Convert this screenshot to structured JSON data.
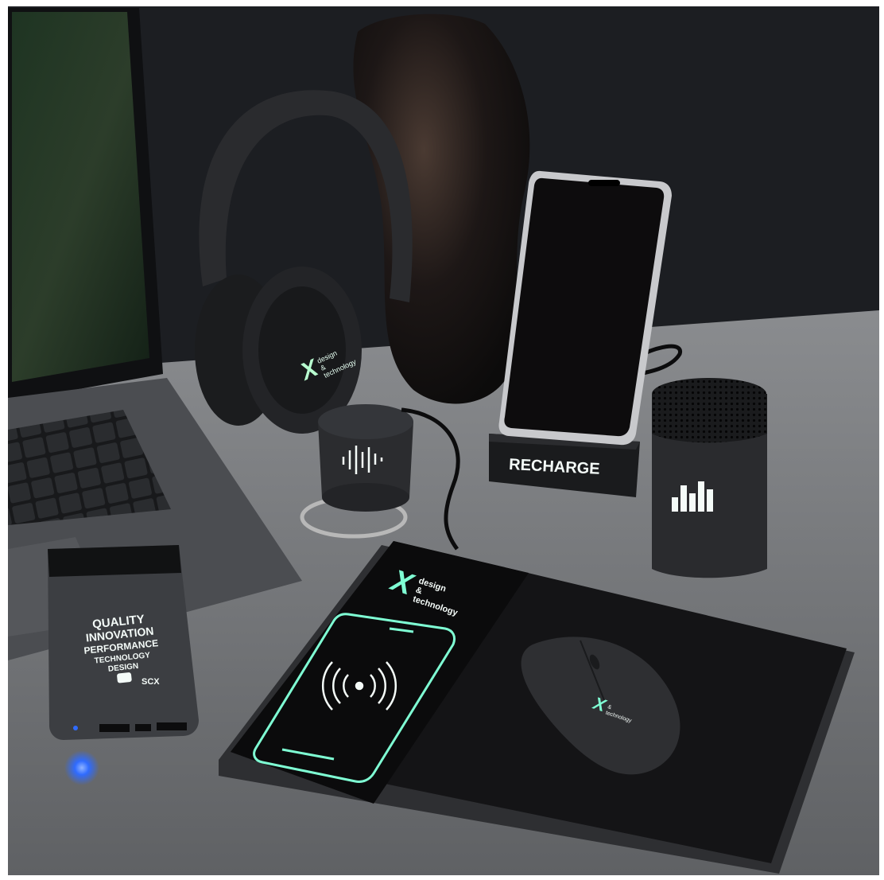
{
  "scene": {
    "headphones_logo": {
      "lines": [
        "design",
        "&",
        "technology"
      ]
    },
    "charger_mat_logo": {
      "lines": [
        "design",
        "&",
        "technology"
      ]
    },
    "mouse_logo": {
      "lines": [
        "&",
        "technology"
      ]
    },
    "phone_stand_label": "RECHARGE",
    "powerbank_words": [
      "QUALITY",
      "INNOVATION",
      "PERFORMANCE",
      "TECHNOLOGY",
      "DESIGN"
    ],
    "powerbank_brand": "SCX",
    "colors": {
      "background": "#1c1e22",
      "desk": "#6f7174",
      "glow_green": "#7fffd4",
      "glow_white": "#f4fbf8",
      "led_blue": "#2f6bff"
    }
  }
}
